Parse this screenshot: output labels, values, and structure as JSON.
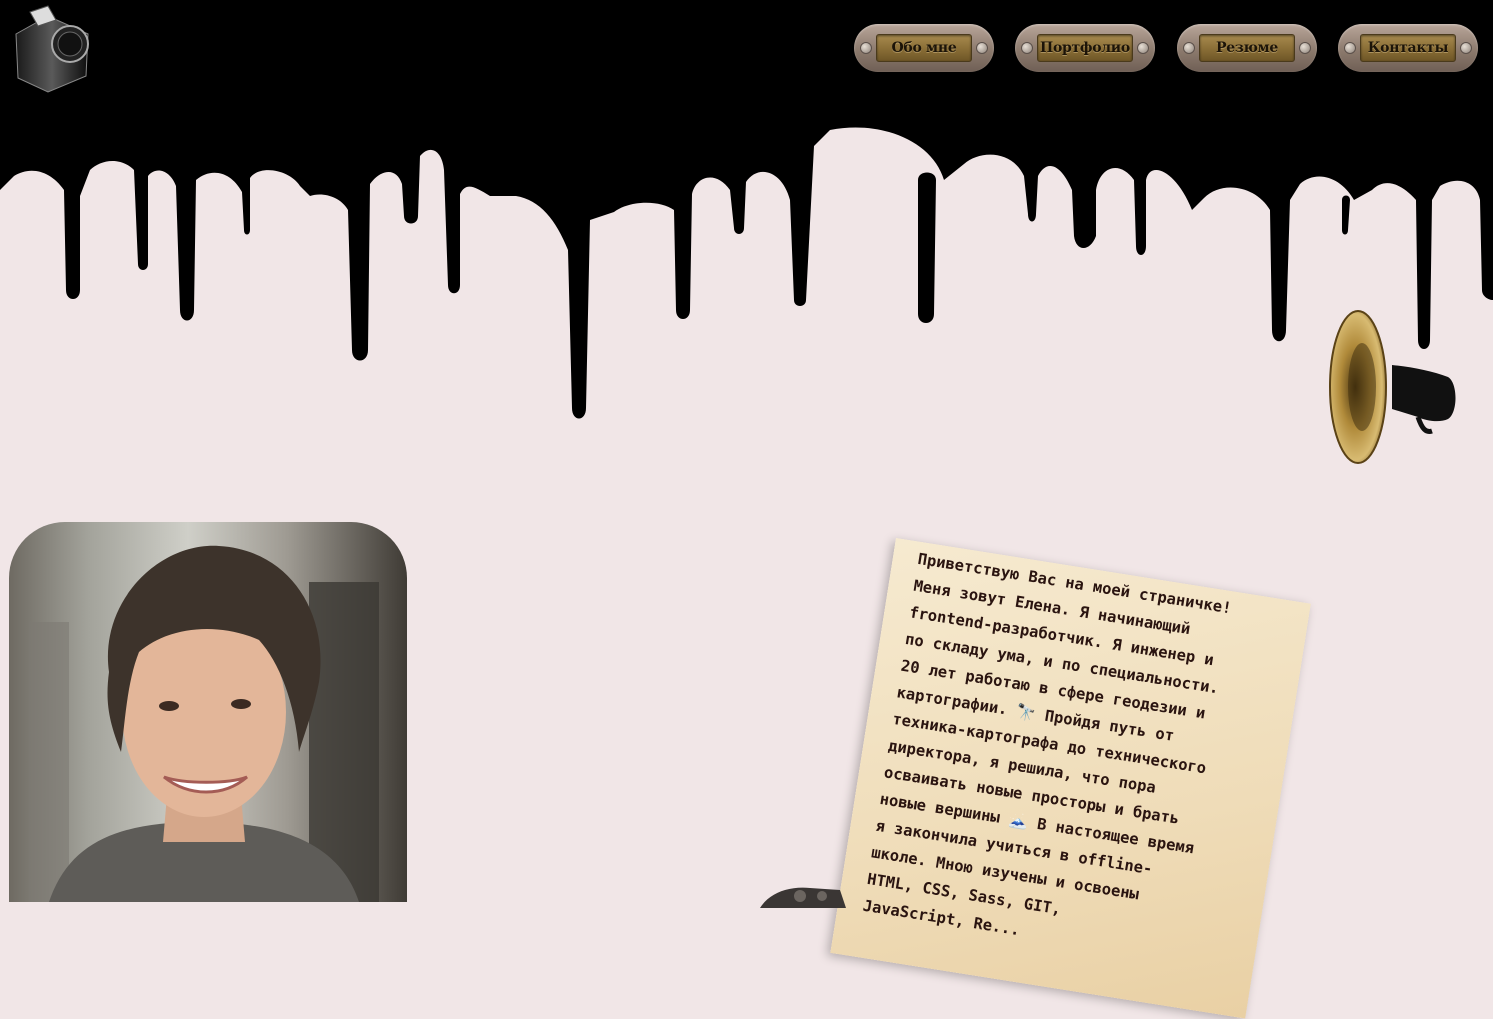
{
  "nav": {
    "items": [
      {
        "label": "Обо мне"
      },
      {
        "label": "Портфолио"
      },
      {
        "label": "Резюме"
      },
      {
        "label": "Контакты"
      }
    ]
  },
  "letter": {
    "text": "Приветствую Вас на моей страничке!\nМеня зовут Елена. Я начинающий\nfrontend-разработчик. Я инженер и\nпо складу ума, и по специальности.\n20 лет работаю в сфере геодезии и\nкартографии. 🔭 Пройдя путь от\nтехника-картографа до технического\nдиректора, я решила, что пора\nосваивать новые просторы и брать\nновые вершины 🗻 В настоящее время\nя закончила учиться в offline-\nшколе. Мною изучены и освоены\nHTML, CSS, Sass, GIT,\nJavaScript, Re..."
  },
  "colors": {
    "background": "#f1e6e7",
    "ink": "#000000",
    "plate_brass": "#8c7038",
    "letter_text": "#2a1410"
  },
  "icons": {
    "logo": "inkwell-icon",
    "horn": "gramophone-horn-icon",
    "typewriter": "typewriter-icon"
  }
}
